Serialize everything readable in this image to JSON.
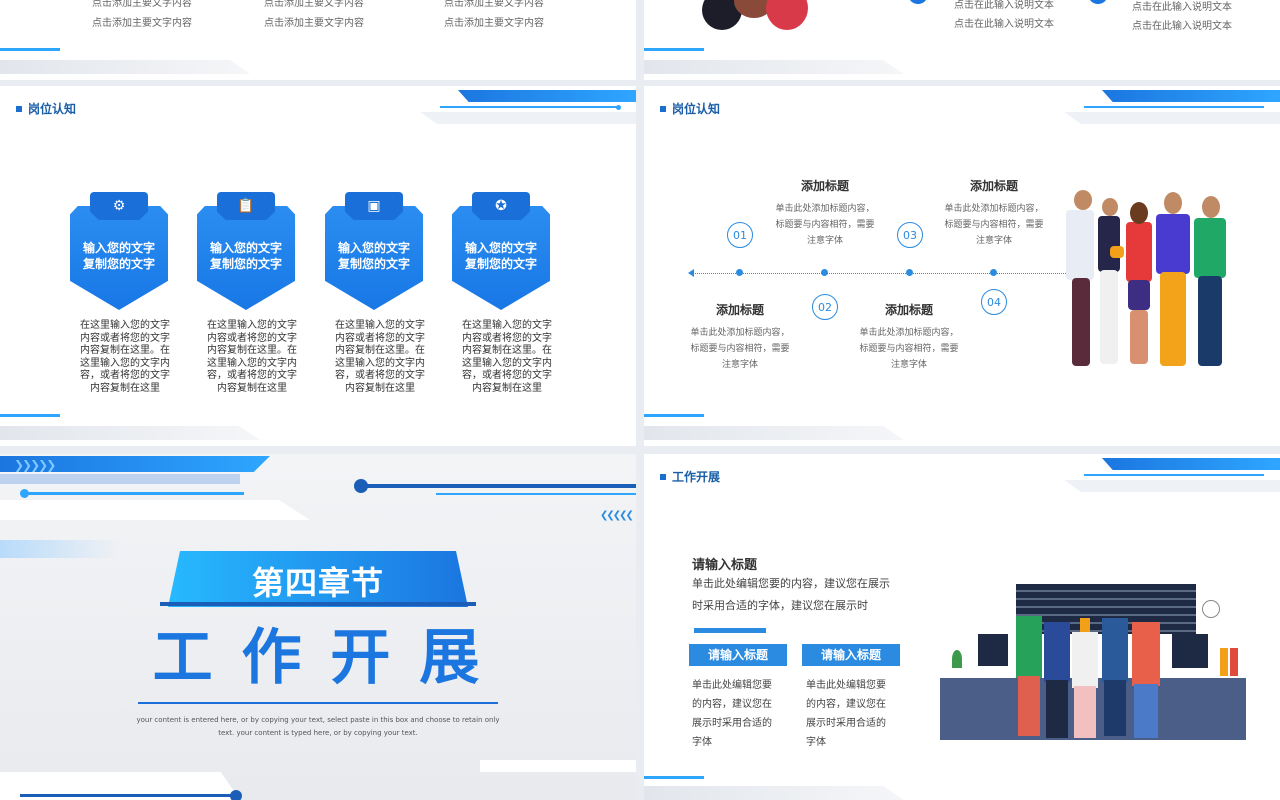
{
  "slide1": {
    "lines": [
      "点击添加主要文字内容",
      "点击添加主要文字内容",
      "点击添加主要文字内容"
    ],
    "lines2": [
      "点击添加主要文字内容",
      "点击添加主要文字内容",
      "点击添加主要文字内容"
    ]
  },
  "slide2": {
    "lines": [
      "点击在此输入说明文本",
      "点击在此输入说明文本",
      "点击在此输入说明文本",
      "点击在此输入说明文本"
    ]
  },
  "slide3": {
    "section_title": "岗位认知",
    "cards": [
      {
        "icon": "gear-icon",
        "label_line1": "输入您的文字",
        "label_line2": "复制您的文字",
        "desc": "在这里输入您的文字内容或者将您的文字内容复制在这里。在这里输入您的文字内容，或者将您的文字内容复制在这里"
      },
      {
        "icon": "clipboard-icon",
        "label_line1": "输入您的文字",
        "label_line2": "复制您的文字",
        "desc": "在这里输入您的文字内容或者将您的文字内容复制在这里。在这里输入您的文字内容，或者将您的文字内容复制在这里"
      },
      {
        "icon": "browser-icon",
        "label_line1": "输入您的文字",
        "label_line2": "复制您的文字",
        "desc": "在这里输入您的文字内容或者将您的文字内容复制在这里。在这里输入您的文字内容，或者将您的文字内容复制在这里"
      },
      {
        "icon": "award-icon",
        "label_line1": "输入您的文字",
        "label_line2": "复制您的文字",
        "desc": "在这里输入您的文字内容或者将您的文字内容复制在这里。在这里输入您的文字内容，或者将您的文字内容复制在这里"
      }
    ]
  },
  "slide4": {
    "section_title": "岗位认知",
    "steps": [
      {
        "num": "01",
        "title": "添加标题",
        "desc": "单击此处添加标题内容，标题要与内容相符，需要注意字体"
      },
      {
        "num": "02",
        "title": "添加标题",
        "desc": "单击此处添加标题内容，标题要与内容相符，需要注意字体"
      },
      {
        "num": "03",
        "title": "添加标题",
        "desc": "单击此处添加标题内容，标题要与内容相符，需要注意字体"
      },
      {
        "num": "04",
        "title": "添加标题",
        "desc": "单击此处添加标题内容，标题要与内容相符，需要注意字体"
      }
    ]
  },
  "slide5": {
    "chapter": "第四章节",
    "title": "工 作 开 展",
    "subtitle_line1": "your content is entered here, or by copying your text, select paste in this box and choose to retain only",
    "subtitle_line2": "text. your content is typed here, or by copying your text."
  },
  "slide6": {
    "section_title": "工作开展",
    "main_heading": "请输入标题",
    "main_text_line1": "单击此处编辑您要的内容，建议您在展示",
    "main_text_line2": "时采用合适的字体，建议您在展示时",
    "sub_cards": [
      {
        "title": "请输入标题",
        "desc": "单击此处编辑您要的内容，建议您在展示时采用合适的字体"
      },
      {
        "title": "请输入标题",
        "desc": "单击此处编辑您要的内容，建议您在展示时采用合适的字体"
      }
    ]
  },
  "colors": {
    "accent": "#1b76e0",
    "light": "#2ea6ff",
    "dark_title": "#1a5ea8"
  }
}
